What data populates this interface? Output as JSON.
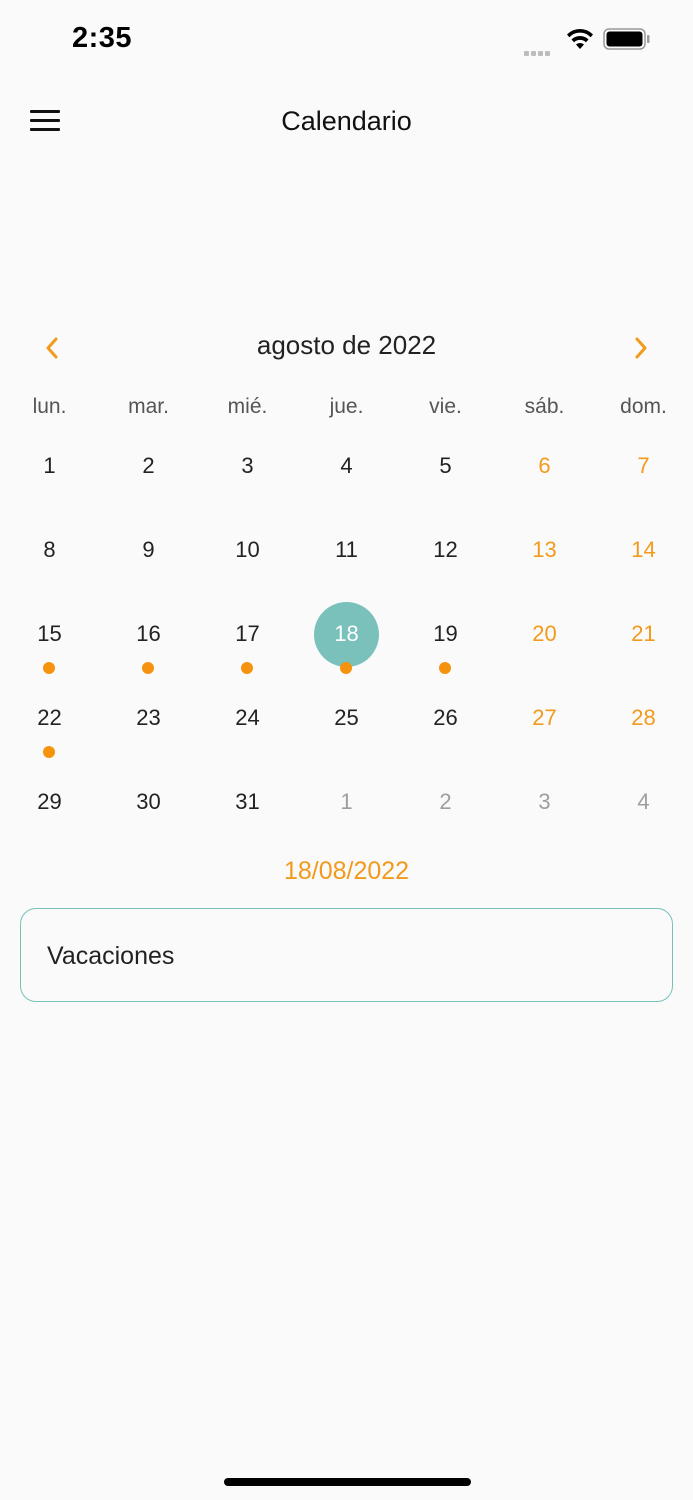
{
  "status": {
    "time": "2:35"
  },
  "app_bar": {
    "title": "Calendario"
  },
  "calendar": {
    "month_title": "agosto de 2022",
    "weekdays": [
      "lun.",
      "mar.",
      "mié.",
      "jue.",
      "vie.",
      "sáb.",
      "dom."
    ],
    "weeks": [
      [
        {
          "d": "1"
        },
        {
          "d": "2"
        },
        {
          "d": "3"
        },
        {
          "d": "4"
        },
        {
          "d": "5"
        },
        {
          "d": "6",
          "weekend": true
        },
        {
          "d": "7",
          "weekend": true
        }
      ],
      [
        {
          "d": "8"
        },
        {
          "d": "9"
        },
        {
          "d": "10"
        },
        {
          "d": "11"
        },
        {
          "d": "12"
        },
        {
          "d": "13",
          "weekend": true
        },
        {
          "d": "14",
          "weekend": true
        }
      ],
      [
        {
          "d": "15",
          "dot": true
        },
        {
          "d": "16",
          "dot": true
        },
        {
          "d": "17",
          "dot": true
        },
        {
          "d": "18",
          "dot": true,
          "selected": true
        },
        {
          "d": "19",
          "dot": true
        },
        {
          "d": "20",
          "weekend": true
        },
        {
          "d": "21",
          "weekend": true
        }
      ],
      [
        {
          "d": "22",
          "dot": true
        },
        {
          "d": "23"
        },
        {
          "d": "24"
        },
        {
          "d": "25"
        },
        {
          "d": "26"
        },
        {
          "d": "27",
          "weekend": true
        },
        {
          "d": "28",
          "weekend": true
        }
      ],
      [
        {
          "d": "29"
        },
        {
          "d": "30"
        },
        {
          "d": "31"
        },
        {
          "d": "1",
          "muted": true
        },
        {
          "d": "2",
          "muted": true
        },
        {
          "d": "3",
          "muted": true
        },
        {
          "d": "4",
          "muted": true
        }
      ]
    ]
  },
  "selected_date": "18/08/2022",
  "events": [
    {
      "title": "Vacaciones"
    }
  ],
  "colors": {
    "accent_orange": "#f39a1c",
    "selected_teal": "#79c1ba",
    "event_dot": "#f5930f"
  }
}
